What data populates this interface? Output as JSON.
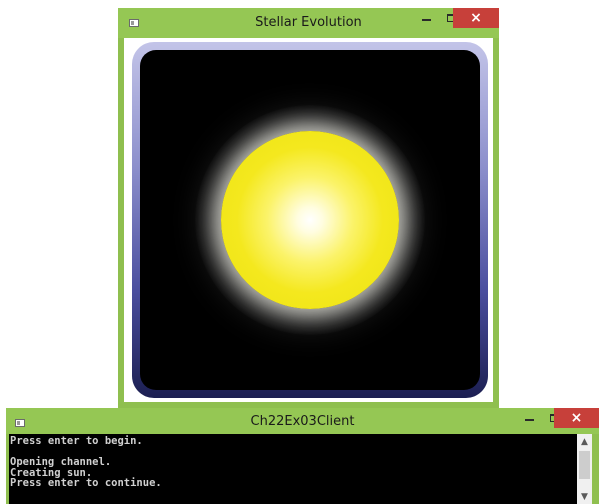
{
  "stellar_window": {
    "title": "Stellar Evolution",
    "controls": {
      "minimize": "minimize",
      "maximize": "maximize",
      "close": "×"
    }
  },
  "console_window": {
    "title": "Ch22Ex03Client",
    "controls": {
      "minimize": "minimize",
      "maximize": "maximize",
      "close": "×"
    },
    "lines": [
      "Press enter to begin.",
      "",
      "Opening channel.",
      "Creating sun.",
      "Press enter to continue."
    ]
  },
  "colors": {
    "title_bar": "#95c754",
    "close_button": "#c7403a",
    "sun": "#f4e81e",
    "frame_top": "#c3c4e8",
    "frame_bottom": "#1c1f52",
    "console_bg": "#000000"
  }
}
